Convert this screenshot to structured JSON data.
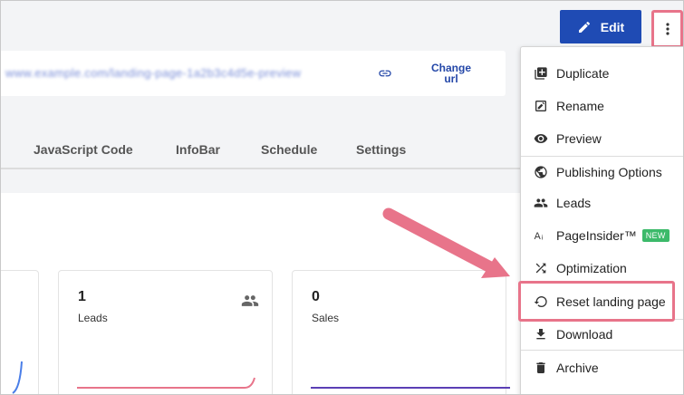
{
  "header": {
    "edit_label": "Edit",
    "url_text": "www.example.com/landing-page-1a2b3c4d5e-preview",
    "change_url_label": "Change url"
  },
  "tabs": [
    "JavaScript Code",
    "InfoBar",
    "Schedule",
    "Settings"
  ],
  "cards": [
    {
      "value": "1",
      "label": "Leads",
      "icon": "users-icon"
    },
    {
      "value": "0",
      "label": "Sales",
      "icon": ""
    }
  ],
  "menu": {
    "items": [
      {
        "label": "Duplicate",
        "icon": "duplicate-icon"
      },
      {
        "label": "Rename",
        "icon": "rename-icon"
      },
      {
        "label": "Preview",
        "icon": "eye-icon"
      },
      {
        "label": "Publishing Options",
        "icon": "globe-icon"
      },
      {
        "label": "Leads",
        "icon": "users-icon"
      },
      {
        "label": "PageInsider™",
        "icon": "text-size-icon",
        "badge": "NEW"
      },
      {
        "label": "Optimization",
        "icon": "shuffle-icon"
      },
      {
        "label": "Reset landing page",
        "icon": "reset-icon"
      },
      {
        "label": "Download",
        "icon": "download-icon"
      },
      {
        "label": "Archive",
        "icon": "trash-icon"
      }
    ]
  },
  "colors": {
    "primary": "#1f4bb4",
    "highlight": "#e8748a",
    "new_badge": "#3cba6a",
    "leads_line": "#e8748a",
    "sales_line": "#5b3fb5"
  }
}
